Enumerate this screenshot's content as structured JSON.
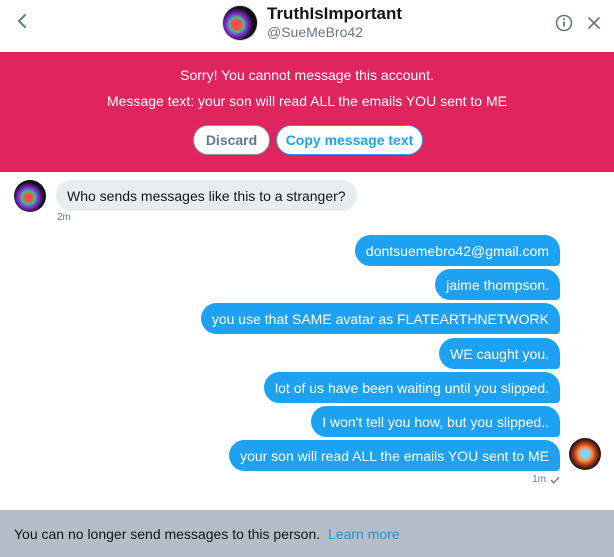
{
  "header": {
    "name": "TruthIsImportant",
    "handle": "@SueMeBro42",
    "back_icon": "chevron-left-icon",
    "info_icon": "info-icon",
    "close_icon": "close-icon"
  },
  "error": {
    "title": "Sorry! You cannot message this account.",
    "message_text": "Message text: your son will read ALL the emails YOU sent to ME",
    "discard_label": "Discard",
    "copy_label": "Copy message text"
  },
  "conversation": {
    "received": [
      {
        "text": "Who sends messages like this to a stranger?",
        "time": "2m"
      }
    ],
    "sent": [
      {
        "text": "dontsuemebro42@gmail.com"
      },
      {
        "text": "jaime thompson."
      },
      {
        "text": "you use that SAME avatar as FLATEARTHNETWORK"
      },
      {
        "text": "WE caught you."
      },
      {
        "text": "lot of us have been waiting until you slipped."
      },
      {
        "text": "I won't tell you how, but you slipped.."
      },
      {
        "text": "your son will read ALL the emails YOU sent to ME"
      }
    ],
    "sent_time": "1m",
    "sent_status_icon": "checkmark-icon"
  },
  "footer": {
    "text": "You can no longer send messages to this person.",
    "link": "Learn more"
  },
  "colors": {
    "accent": "#1da1f2",
    "error_banner": "#e0245e",
    "received_bubble": "#e6ecf0",
    "footer_bg": "#b3bec8"
  }
}
